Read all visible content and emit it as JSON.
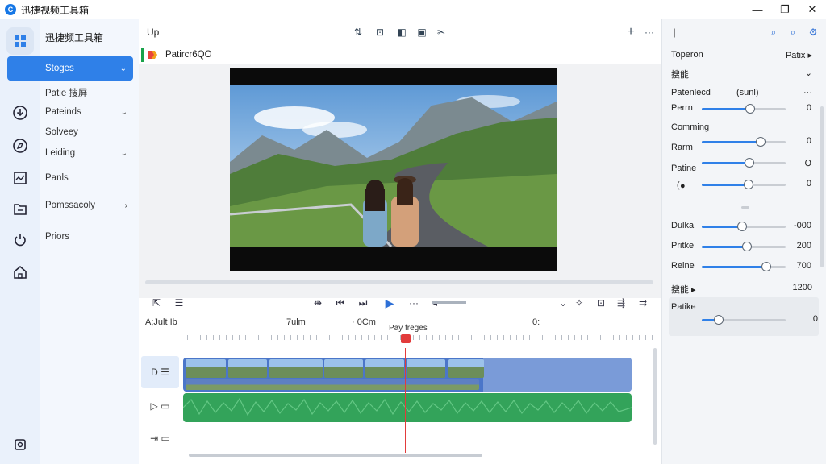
{
  "app": {
    "title": "迅捷视频工具箱",
    "window_controls": [
      "minimize-icon",
      "restore-icon",
      "close-icon"
    ]
  },
  "rail": {
    "icons": [
      "apps-grid-icon",
      "download-icon",
      "compass-icon",
      "chart-icon",
      "folder-icon",
      "power-icon",
      "home-icon",
      "settings-icon"
    ]
  },
  "menu": {
    "header": "迅捷频工具箱",
    "items": [
      {
        "label": "Stoges",
        "chevron": "⌄",
        "active": true
      },
      {
        "label": "Patie 搜屏",
        "chevron": ""
      },
      {
        "label": "Pateinds",
        "chevron": "⌄"
      },
      {
        "label": "Solveey",
        "chevron": ""
      },
      {
        "label": "Leiding",
        "chevron": "⌄"
      },
      {
        "label": "Panls",
        "chevron": ""
      },
      {
        "label": "Pomssacoly",
        "chevron": "›"
      },
      {
        "label": "Priors",
        "chevron": ""
      }
    ]
  },
  "toolbar": {
    "label": "Up",
    "icons": [
      "swap-icon",
      "crop-icon",
      "split-icon",
      "image-icon",
      "cut-icon"
    ],
    "add": "+",
    "more": "···"
  },
  "project": {
    "name": "Patircr6QO"
  },
  "playback": {
    "left_icons": [
      "export-icon",
      "list-icon"
    ],
    "transport": [
      "rewind-icon",
      "prev-frame-icon",
      "next-frame-icon",
      "play-icon",
      "more-icon",
      "volume-icon"
    ],
    "right_icons": [
      "dropdown-icon",
      "magic-icon",
      "fit-icon",
      "align-icon",
      "expand-icon"
    ]
  },
  "timeline": {
    "label": "A;Jult Ib",
    "marks": [
      "7ulm",
      "· 0Cm",
      "0:"
    ],
    "playhead_label": "Pay freges"
  },
  "tracks": [
    {
      "icons": "D ☰",
      "kind": "video",
      "active": true
    },
    {
      "icons": "▷ ▭",
      "kind": "audio",
      "active": false
    },
    {
      "icons": "⇥ ▭",
      "kind": "empty",
      "active": false
    }
  ],
  "right_panel": {
    "top_icons": [
      "search-icon",
      "zoom-icon",
      "settings-icon"
    ],
    "row1": {
      "label": "Toperon",
      "value": "Patix ▸"
    },
    "row2": {
      "label": "搜能",
      "value": "⌄"
    },
    "row3": {
      "label": "Patenlecd",
      "hint": "(sunl)",
      "value": "···"
    },
    "sliders": [
      {
        "label": "Perrn",
        "value": 0.58,
        "number": "0"
      },
      {
        "label": "Rarm",
        "value": 0.7,
        "number": "0"
      },
      {
        "label": "Patine",
        "value": 0.57,
        "number": "Ꝺ"
      },
      {
        "label": "（●",
        "value": 0.56,
        "number": "0"
      },
      {
        "label": "Dulka",
        "value": 0.48,
        "number": "-000"
      },
      {
        "label": "Pritke",
        "value": 0.54,
        "number": "200"
      },
      {
        "label": "Relne",
        "value": 0.77,
        "number": "700"
      },
      {
        "label": "",
        "value": 0.2,
        "number": "0"
      }
    ],
    "section_coming": "Comming",
    "row_bottom": {
      "label": "搜能 ▸",
      "value": "1200"
    },
    "box_label": "Patike"
  }
}
